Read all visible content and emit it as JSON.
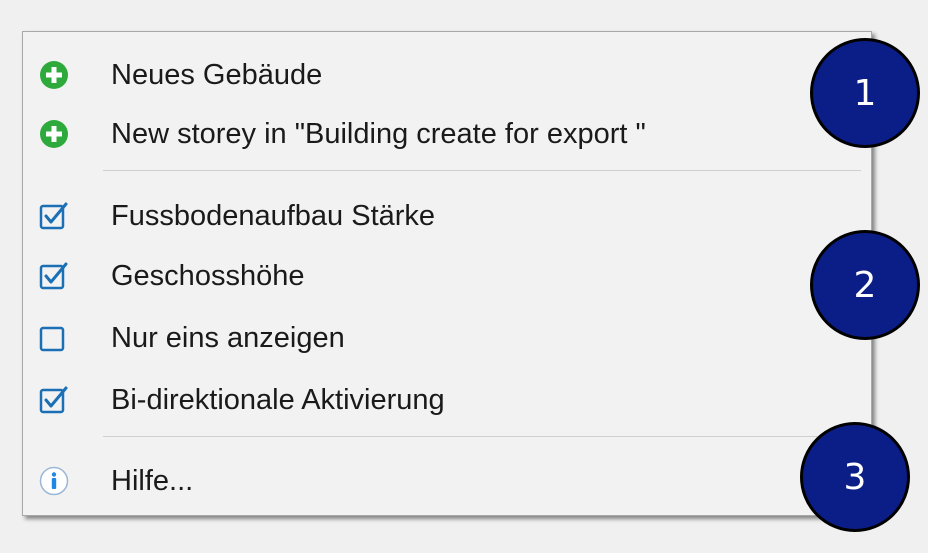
{
  "menu": {
    "items": [
      {
        "label": "Neues Gebäude",
        "icon": "add-icon",
        "type": "command"
      },
      {
        "label": "New storey in \"Building create for export \"",
        "icon": "add-icon",
        "type": "command"
      },
      {
        "label": "Fussbodenaufbau Stärke",
        "icon": "checkbox",
        "type": "check",
        "checked": true
      },
      {
        "label": "Geschosshöhe",
        "icon": "checkbox",
        "type": "check",
        "checked": true
      },
      {
        "label": "Nur eins anzeigen",
        "icon": "checkbox",
        "type": "check",
        "checked": false
      },
      {
        "label": "Bi-direktionale Aktivierung",
        "icon": "checkbox",
        "type": "check",
        "checked": true
      },
      {
        "label": "Hilfe...",
        "icon": "info-icon",
        "type": "command"
      }
    ]
  },
  "callouts": [
    "1",
    "2",
    "3"
  ],
  "colors": {
    "add_green": "#2eaa3c",
    "check_blue": "#1a6fb5",
    "info_blue": "#1e88e5",
    "callout_fill": "#0b1d86",
    "menu_bg": "#f2f2f2"
  }
}
